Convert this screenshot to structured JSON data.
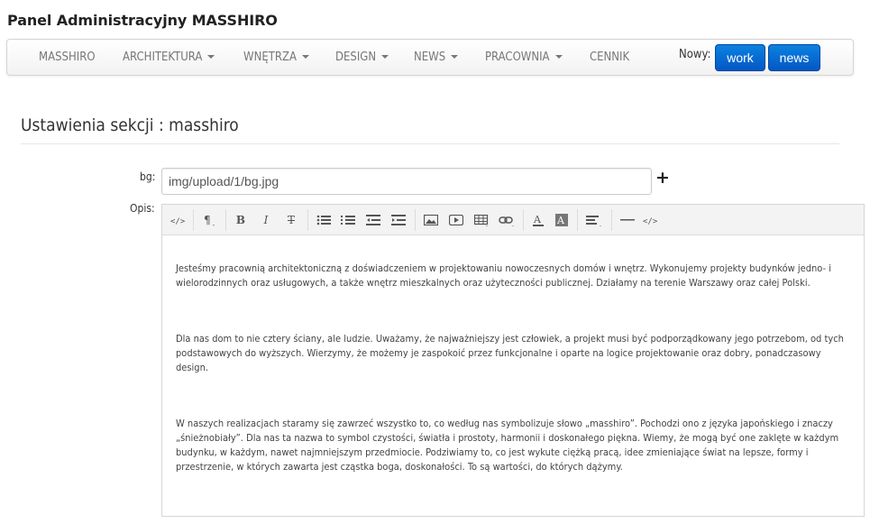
{
  "app": {
    "title": "Panel Administracyjny MASSHIRO"
  },
  "nav": {
    "items": [
      {
        "label": "MASSHIRO",
        "dropdown": false
      },
      {
        "label": "ARCHITEKTURA",
        "dropdown": true
      },
      {
        "label": "WNĘTRZA",
        "dropdown": true
      },
      {
        "label": "DESIGN",
        "dropdown": true
      },
      {
        "label": "NEWS",
        "dropdown": true
      },
      {
        "label": "PRACOWNIA",
        "dropdown": true
      },
      {
        "label": "CENNIK",
        "dropdown": false
      }
    ],
    "nowy_label": "Nowy:",
    "buttons": [
      {
        "label": "work"
      },
      {
        "label": "news"
      }
    ],
    "button_color": "#0a6fd6"
  },
  "section": {
    "heading": "Ustawienia sekcji : masshiro"
  },
  "form": {
    "bg_label": "bg:",
    "bg_value": "img/upload/1/bg.jpg",
    "opis_label": "Opis:"
  },
  "editor": {
    "toolbar_icons": [
      "code-view-icon",
      "paragraph-style-icon",
      "bold-icon",
      "italic-icon",
      "strikethrough-icon",
      "unordered-list-icon",
      "ordered-list-icon",
      "outdent-icon",
      "indent-icon",
      "image-icon",
      "video-icon",
      "table-icon",
      "link-icon",
      "font-color-icon",
      "background-color-icon",
      "align-icon",
      "horizontal-rule-icon",
      "html-icon"
    ],
    "paragraphs": [
      "Jesteśmy pracownią architektoniczną z doświadczeniem w projektowaniu nowoczesnych domów i wnętrz. Wykonujemy projekty budynków jedno- i wielorodzinnych oraz usługowych, a także wnętrz mieszkalnych oraz użyteczności publicznej. Działamy na terenie Warszawy oraz całej Polski.",
      "Dla nas dom to nie cztery ściany, ale ludzie. Uważamy, że najważniejszy jest człowiek, a projekt musi być podporządkowany jego potrzebom, od tych podstawowych do wyższych. Wierzymy, że możemy je zaspokoić przez funkcjonalne i oparte na logice projektowanie oraz dobry, ponadczasowy design.",
      "W naszych realizacjach staramy się zawrzeć wszystko to, co według nas symbolizuje słowo „masshiro”. Pochodzi ono z języka japońskiego i znaczy „śnieżnobiały”. Dla nas ta nazwa to symbol czystości, światła i prostoty, harmonii i doskonałego piękna. Wiemy, że mogą być one zaklęte w każdym budynku, w każdym, nawet najmniejszym przedmiocie. Podziwiamy to, co jest wykute ciężką pracą, idee zmieniające świat na lepsze, formy i przestrzenie, w których zawarta jest cząstka boga, doskonałości. To są wartości, do których dążymy."
    ]
  }
}
